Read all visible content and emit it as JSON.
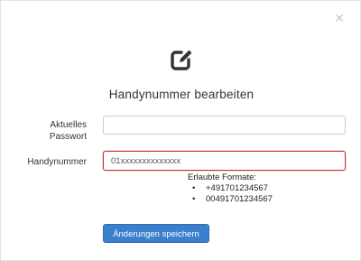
{
  "modal": {
    "title": "Handynummer bearbeiten",
    "close_icon": "close-icon",
    "header_icon": "edit-square-icon"
  },
  "form": {
    "password": {
      "label": "Aktuelles Passwort",
      "value": "",
      "placeholder": ""
    },
    "phone": {
      "label": "Handynummer",
      "value": "01xxxxxxxxxxxxxx",
      "state": "error",
      "border_color": "#c9302c"
    },
    "formats": {
      "title": "Erlaubte Formate:",
      "items": [
        "+491701234567",
        "00491701234567"
      ]
    },
    "save_label": "Änderungen speichern"
  },
  "colors": {
    "primary": "#3a80cc",
    "error": "#c9302c",
    "text": "#333333"
  }
}
